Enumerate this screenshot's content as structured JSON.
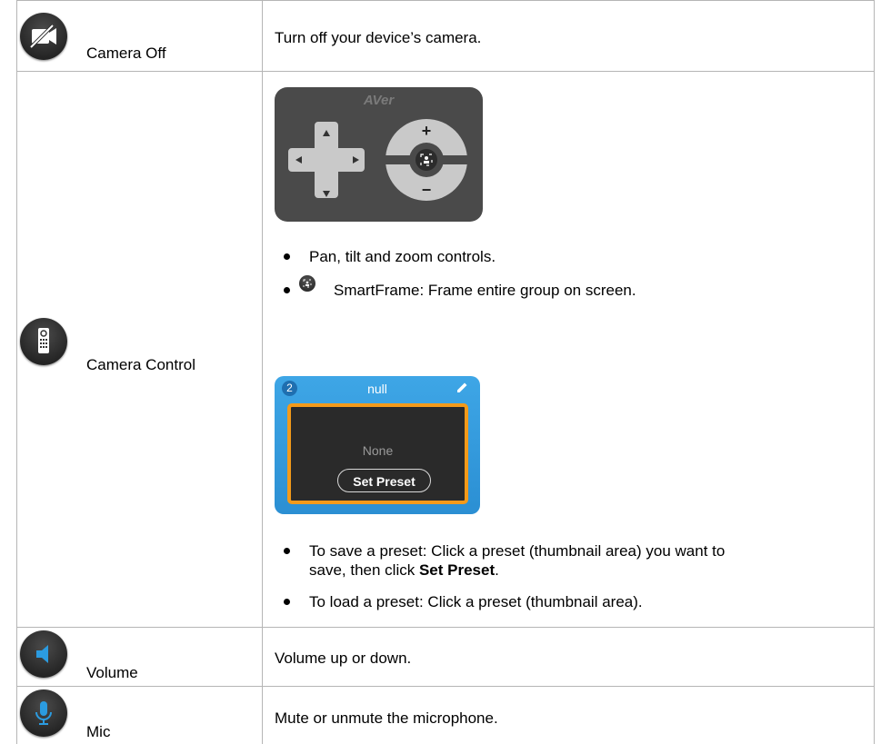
{
  "rows": [
    {
      "label": "Camera Off",
      "icon": "camera-off-icon",
      "description": "Turn off your device’s camera."
    },
    {
      "label": "Camera Control",
      "icon": "remote-control-icon",
      "pad": {
        "brand": "AVer",
        "plus": "+",
        "minus": "−"
      },
      "bullets_top": [
        "Pan, tilt and zoom controls.",
        "SmartFrame: Frame entire group on screen."
      ],
      "preset_card": {
        "number": "2",
        "name": "null",
        "status": "None",
        "button": "Set Preset"
      },
      "bullets_bottom": {
        "save_line1": "To save a preset: Click a preset (thumbnail area) you want to",
        "save_line2_prefix": "save, then click ",
        "save_line2_bold": "Set Preset",
        "save_line2_suffix": ".",
        "load": "To load a preset: Click a preset (thumbnail area)."
      }
    },
    {
      "label": "Volume",
      "icon": "speaker-icon",
      "description": "Volume up or down."
    },
    {
      "label": "Mic",
      "icon": "microphone-icon",
      "description": "Mute or unmute the microphone."
    }
  ],
  "colors": {
    "border": "#b5b5b5",
    "accent_blue": "#2b9be0",
    "preset_orange": "#f39a1a",
    "pad_gray": "#4a4a4a"
  }
}
